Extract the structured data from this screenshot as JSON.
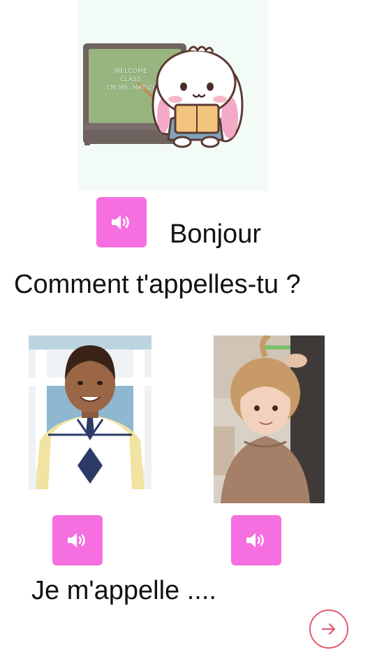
{
  "illustration": {
    "board_lines": [
      "WELCOME",
      "CLASS",
      "I'M MS. MATIZI"
    ],
    "colors": {
      "background": "#f3fbf7",
      "board": "#98b57f",
      "frame": "#6f6360",
      "bunny_ear": "#f4a9c6"
    }
  },
  "greeting": "Bonjour",
  "question": "Comment t'appelles-tu ?",
  "answer": "Je m'appelle ....",
  "icons": {
    "sound": "speaker-icon",
    "next": "arrow-right-icon"
  },
  "colors": {
    "sound_button": "#f56fe0",
    "next_button": "#e35a6e",
    "text": "#111111"
  }
}
